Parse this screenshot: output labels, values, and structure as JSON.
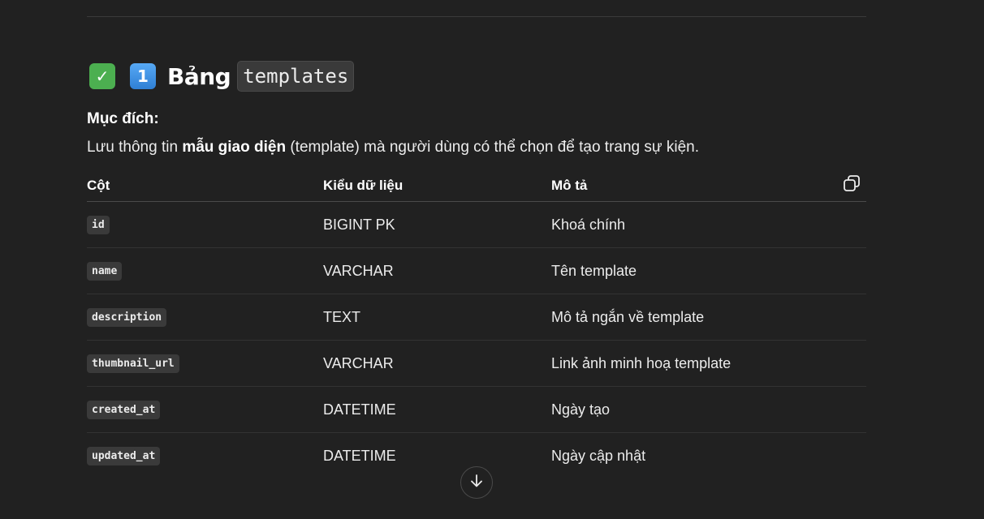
{
  "heading": {
    "check_emoji": "✓",
    "number_emoji": "1",
    "title": "Bảng",
    "code": "templates"
  },
  "purpose": {
    "label": "Mục đích:",
    "text_before": "Lưu thông tin ",
    "text_bold": "mẫu giao diện",
    "text_after": " (template) mà người dùng có thể chọn để tạo trang sự kiện."
  },
  "table": {
    "headers": [
      "Cột",
      "Kiểu dữ liệu",
      "Mô tả"
    ],
    "rows": [
      {
        "column": "id",
        "type": "BIGINT PK",
        "description": "Khoá chính"
      },
      {
        "column": "name",
        "type": "VARCHAR",
        "description": "Tên template"
      },
      {
        "column": "description",
        "type": "TEXT",
        "description": "Mô tả ngắn về template"
      },
      {
        "column": "thumbnail_url",
        "type": "VARCHAR",
        "description": "Link ảnh minh hoạ template"
      },
      {
        "column": "created_at",
        "type": "DATETIME",
        "description": "Ngày tạo"
      },
      {
        "column": "updated_at",
        "type": "DATETIME",
        "description": "Ngày cập nhật"
      }
    ]
  },
  "icons": {
    "copy": "copy-icon",
    "scroll_down": "arrow-down-icon"
  },
  "colors": {
    "background": "#212121",
    "check_green": "#4caf50",
    "number_blue": "#3b8de0"
  }
}
